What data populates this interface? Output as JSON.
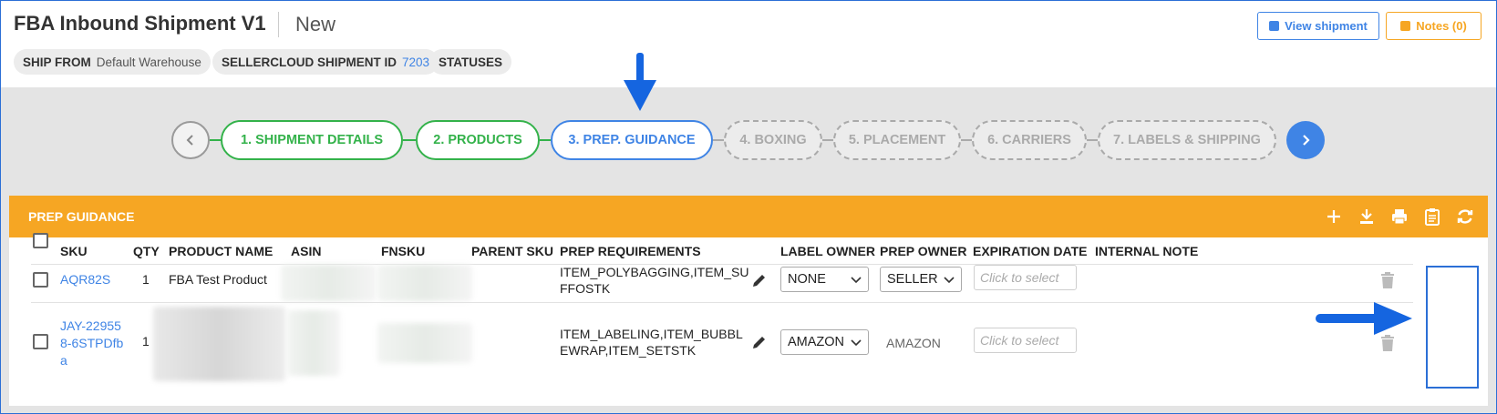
{
  "header": {
    "title": "FBA Inbound Shipment V1",
    "status": "New",
    "view_shipment_label": "View shipment",
    "notes_label": "Notes (0)",
    "chips": {
      "ship_from_label": "SHIP FROM",
      "ship_from_value": "Default Warehouse",
      "shipment_id_label": "SELLERCLOUD SHIPMENT ID",
      "shipment_id_value": "7203",
      "statuses_label": "STATUSES"
    }
  },
  "steps": [
    {
      "label": "1. SHIPMENT DETAILS",
      "state": "done"
    },
    {
      "label": "2. PRODUCTS",
      "state": "done"
    },
    {
      "label": "3. PREP. GUIDANCE",
      "state": "active"
    },
    {
      "label": "4. BOXING",
      "state": "pending"
    },
    {
      "label": "5. PLACEMENT",
      "state": "pending"
    },
    {
      "label": "6. CARRIERS",
      "state": "pending"
    },
    {
      "label": "7. LABELS & SHIPPING",
      "state": "pending"
    }
  ],
  "panel": {
    "title": "PREP GUIDANCE",
    "columns": {
      "sku": "SKU",
      "qty": "QTY",
      "product_name": "PRODUCT NAME",
      "asin": "ASIN",
      "fnsku": "FNSKU",
      "parent_sku": "PARENT SKU",
      "prep_requirements": "PREP REQUIREMENTS",
      "label_owner": "LABEL OWNER",
      "prep_owner": "PREP OWNER",
      "expiration_date": "EXPIRATION DATE",
      "internal_note": "INTERNAL NOTE"
    },
    "rows": [
      {
        "sku": "AQR82S",
        "qty": "1",
        "product_name": "FBA Test Product",
        "prep_requirements": "ITEM_POLYBAGGING,ITEM_SUFFOSTK",
        "label_owner": "NONE",
        "prep_owner": "SELLER",
        "expiration_placeholder": "Click to select"
      },
      {
        "sku": "JAY-229558-6STPDfba",
        "qty": "1",
        "product_name": "",
        "prep_requirements": "ITEM_LABELING,ITEM_BUBBLEWRAP,ITEM_SETSTK",
        "label_owner": "AMAZON",
        "prep_owner": "AMAZON",
        "expiration_placeholder": "Click to select"
      }
    ]
  },
  "colors": {
    "accent_blue": "#3f84e5",
    "done_green": "#33b24a",
    "panel_orange": "#f6a623"
  }
}
